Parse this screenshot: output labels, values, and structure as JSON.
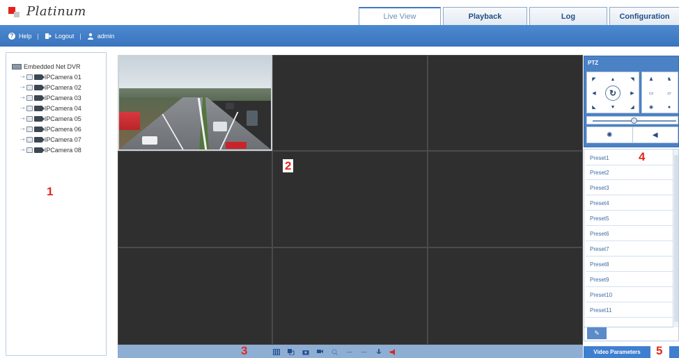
{
  "brand": {
    "name": "Platinum"
  },
  "tabs": [
    {
      "label": "Live View",
      "active": true
    },
    {
      "label": "Playback",
      "active": false
    },
    {
      "label": "Log",
      "active": false
    },
    {
      "label": "Configuration",
      "active": false
    }
  ],
  "topbar": {
    "help": "Help",
    "logout": "Logout",
    "user": "admin",
    "separator": "|"
  },
  "device_tree": {
    "root": "Embedded Net DVR",
    "cameras": [
      "IPCamera 01",
      "IPCamera 02",
      "IPCamera 03",
      "IPCamera 04",
      "IPCamera 05",
      "IPCamera 06",
      "IPCamera 07",
      "IPCamera 08"
    ]
  },
  "markers": {
    "m1": "1",
    "m2": "2",
    "m3": "3",
    "m4": "4",
    "m5": "5"
  },
  "ptz": {
    "title": "PTZ",
    "presets": [
      "Preset1",
      "Preset2",
      "Preset3",
      "Preset4",
      "Preset5",
      "Preset6",
      "Preset7",
      "Preset8",
      "Preset9",
      "Preset10",
      "Preset11"
    ]
  },
  "video_parameters_label": "Video Parameters",
  "icons": {
    "toolbar": [
      "window-split-icon",
      "preview-all-icon",
      "capture-icon",
      "record-icon",
      "zoom-icon",
      "prev-page-icon",
      "next-page-icon",
      "volume-icon",
      "audio-toggle-icon"
    ]
  },
  "colors": {
    "topbar": "#3a74bd",
    "accent": "#e02a1f",
    "video_bg": "#2f2f2f"
  }
}
